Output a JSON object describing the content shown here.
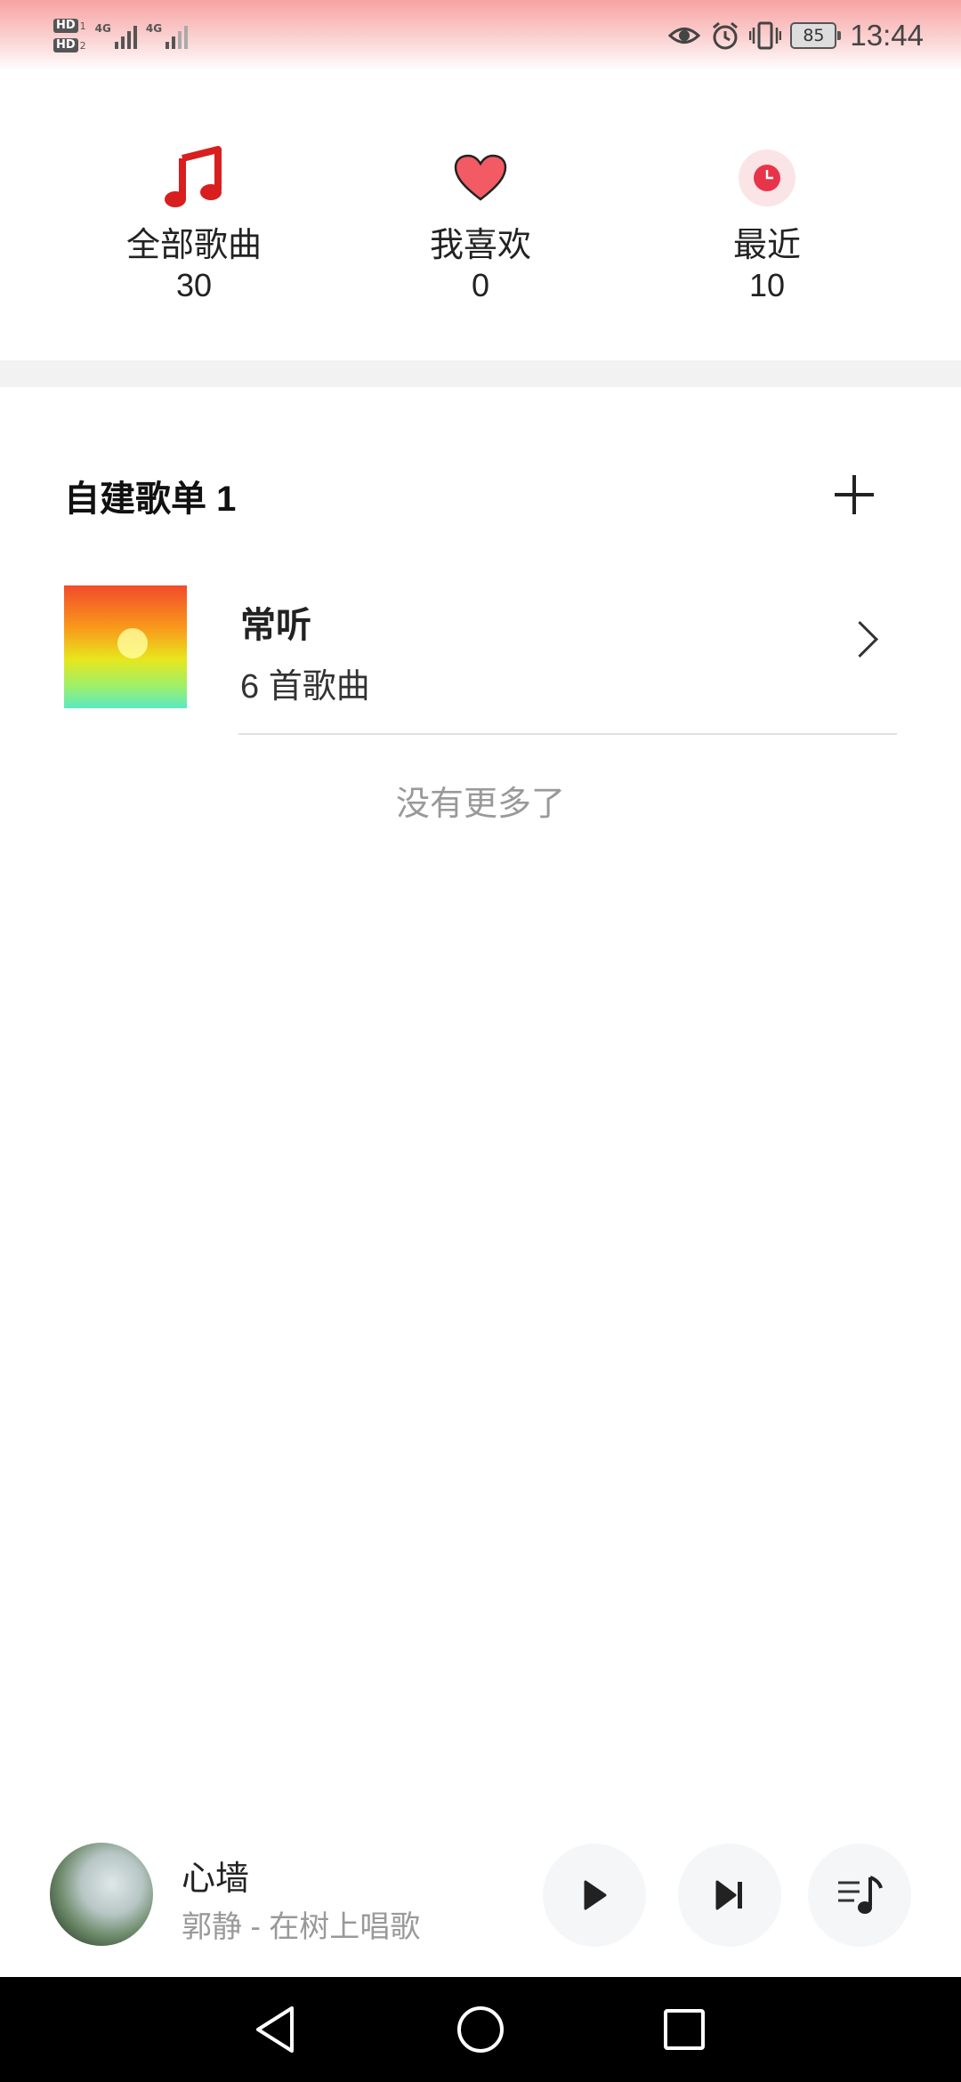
{
  "status_bar": {
    "sim1_label": "HD",
    "sim1_index": "1",
    "sim2_label": "HD",
    "sim2_index": "2",
    "network1": "4G",
    "network2": "4G",
    "battery_level": "85",
    "time": "13:44",
    "icons": [
      "eye-comfort-icon",
      "alarm-icon",
      "vibrate-icon",
      "battery-icon"
    ]
  },
  "quick_access": [
    {
      "label": "全部歌曲",
      "count": "30",
      "icon": "music-note-icon",
      "color": "#d81e1e"
    },
    {
      "label": "我喜欢",
      "count": "0",
      "icon": "heart-icon",
      "color": "#f25b63"
    },
    {
      "label": "最近",
      "count": "10",
      "icon": "clock-icon",
      "color": "#e8344a"
    }
  ],
  "playlists_section": {
    "title": "自建歌单 1",
    "add_icon": "plus-icon"
  },
  "playlists": [
    {
      "name": "常听",
      "count_label": "6 首歌曲"
    }
  ],
  "end_text": "没有更多了",
  "player": {
    "title": "心墙",
    "subtitle": "郭静 - 在树上唱歌",
    "controls": [
      "play-icon",
      "next-icon",
      "playlist-queue-icon"
    ]
  },
  "nav_bar": {
    "buttons": [
      "back-icon",
      "home-icon",
      "recents-icon"
    ]
  }
}
